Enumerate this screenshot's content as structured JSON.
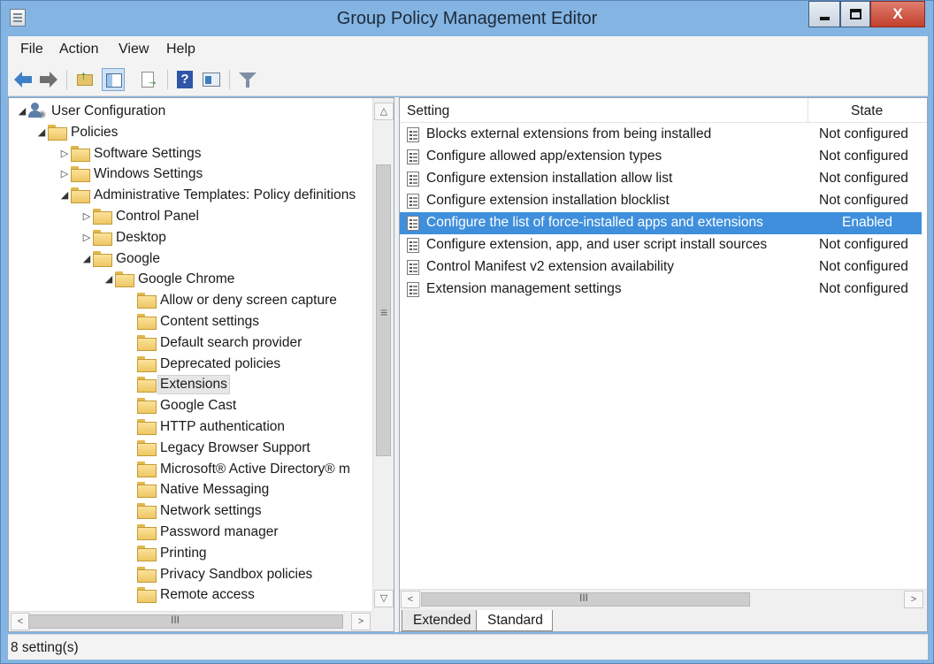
{
  "window": {
    "title": "Group Policy Management Editor",
    "close_glyph": "X"
  },
  "menu": [
    "File",
    "Action",
    "View",
    "Help"
  ],
  "toolbar": {
    "icons": [
      "back-arrow-icon",
      "forward-arrow-icon",
      "up-folder-icon",
      "show-hide-tree-icon",
      "export-list-icon",
      "help-icon",
      "properties-icon",
      "filter-icon"
    ]
  },
  "tree": {
    "items": [
      {
        "label": "User Configuration",
        "expander": "◢",
        "icon": "user-config-icon"
      },
      {
        "label": "Policies",
        "expander": "◢",
        "icon": "folder-icon"
      },
      {
        "label": "Software Settings",
        "expander": "▷",
        "icon": "folder-icon"
      },
      {
        "label": "Windows Settings",
        "expander": "▷",
        "icon": "folder-icon"
      },
      {
        "label": "Administrative Templates: Policy definitions",
        "expander": "◢",
        "icon": "folder-icon"
      },
      {
        "label": "Control Panel",
        "expander": "▷",
        "icon": "folder-icon"
      },
      {
        "label": "Desktop",
        "expander": "▷",
        "icon": "folder-icon"
      },
      {
        "label": "Google",
        "expander": "◢",
        "icon": "folder-icon"
      },
      {
        "label": "Google Chrome",
        "expander": "◢",
        "icon": "folder-icon"
      },
      {
        "label": "Allow or deny screen capture",
        "expander": "",
        "icon": "folder-icon"
      },
      {
        "label": "Content settings",
        "expander": "",
        "icon": "folder-icon"
      },
      {
        "label": "Default search provider",
        "expander": "",
        "icon": "folder-icon"
      },
      {
        "label": "Deprecated policies",
        "expander": "",
        "icon": "folder-icon"
      },
      {
        "label": "Extensions",
        "expander": "",
        "icon": "folder-icon",
        "selected": true
      },
      {
        "label": "Google Cast",
        "expander": "",
        "icon": "folder-icon"
      },
      {
        "label": "HTTP authentication",
        "expander": "",
        "icon": "folder-icon"
      },
      {
        "label": "Legacy Browser Support",
        "expander": "",
        "icon": "folder-icon"
      },
      {
        "label": "Microsoft® Active Directory® m",
        "expander": "",
        "icon": "folder-icon"
      },
      {
        "label": "Native Messaging",
        "expander": "",
        "icon": "folder-icon"
      },
      {
        "label": "Network settings",
        "expander": "",
        "icon": "folder-icon"
      },
      {
        "label": "Password manager",
        "expander": "",
        "icon": "folder-icon"
      },
      {
        "label": "Printing",
        "expander": "",
        "icon": "folder-icon"
      },
      {
        "label": "Privacy Sandbox policies",
        "expander": "",
        "icon": "folder-icon"
      },
      {
        "label": "Remote access",
        "expander": "",
        "icon": "folder-icon"
      }
    ]
  },
  "list": {
    "columns": {
      "setting": "Setting",
      "state": "State"
    },
    "rows": [
      {
        "setting": "Blocks external extensions from being installed",
        "state": "Not configured"
      },
      {
        "setting": "Configure allowed app/extension types",
        "state": "Not configured"
      },
      {
        "setting": "Configure extension installation allow list",
        "state": "Not configured"
      },
      {
        "setting": "Configure extension installation blocklist",
        "state": "Not configured"
      },
      {
        "setting": "Configure the list of force-installed apps and extensions",
        "state": "Enabled",
        "selected": true
      },
      {
        "setting": "Configure extension, app, and user script install sources",
        "state": "Not configured"
      },
      {
        "setting": "Control Manifest v2 extension availability",
        "state": "Not configured"
      },
      {
        "setting": "Extension management settings",
        "state": "Not configured"
      }
    ]
  },
  "tabs": [
    "Extended",
    "Standard"
  ],
  "active_tab": "Standard",
  "scroll": {
    "grip": "≡",
    "hgrip": "III"
  },
  "status": {
    "text": "8 setting(s)"
  },
  "colors": {
    "selection": "#3f8fdc",
    "window_frame": "#84b4e2"
  }
}
